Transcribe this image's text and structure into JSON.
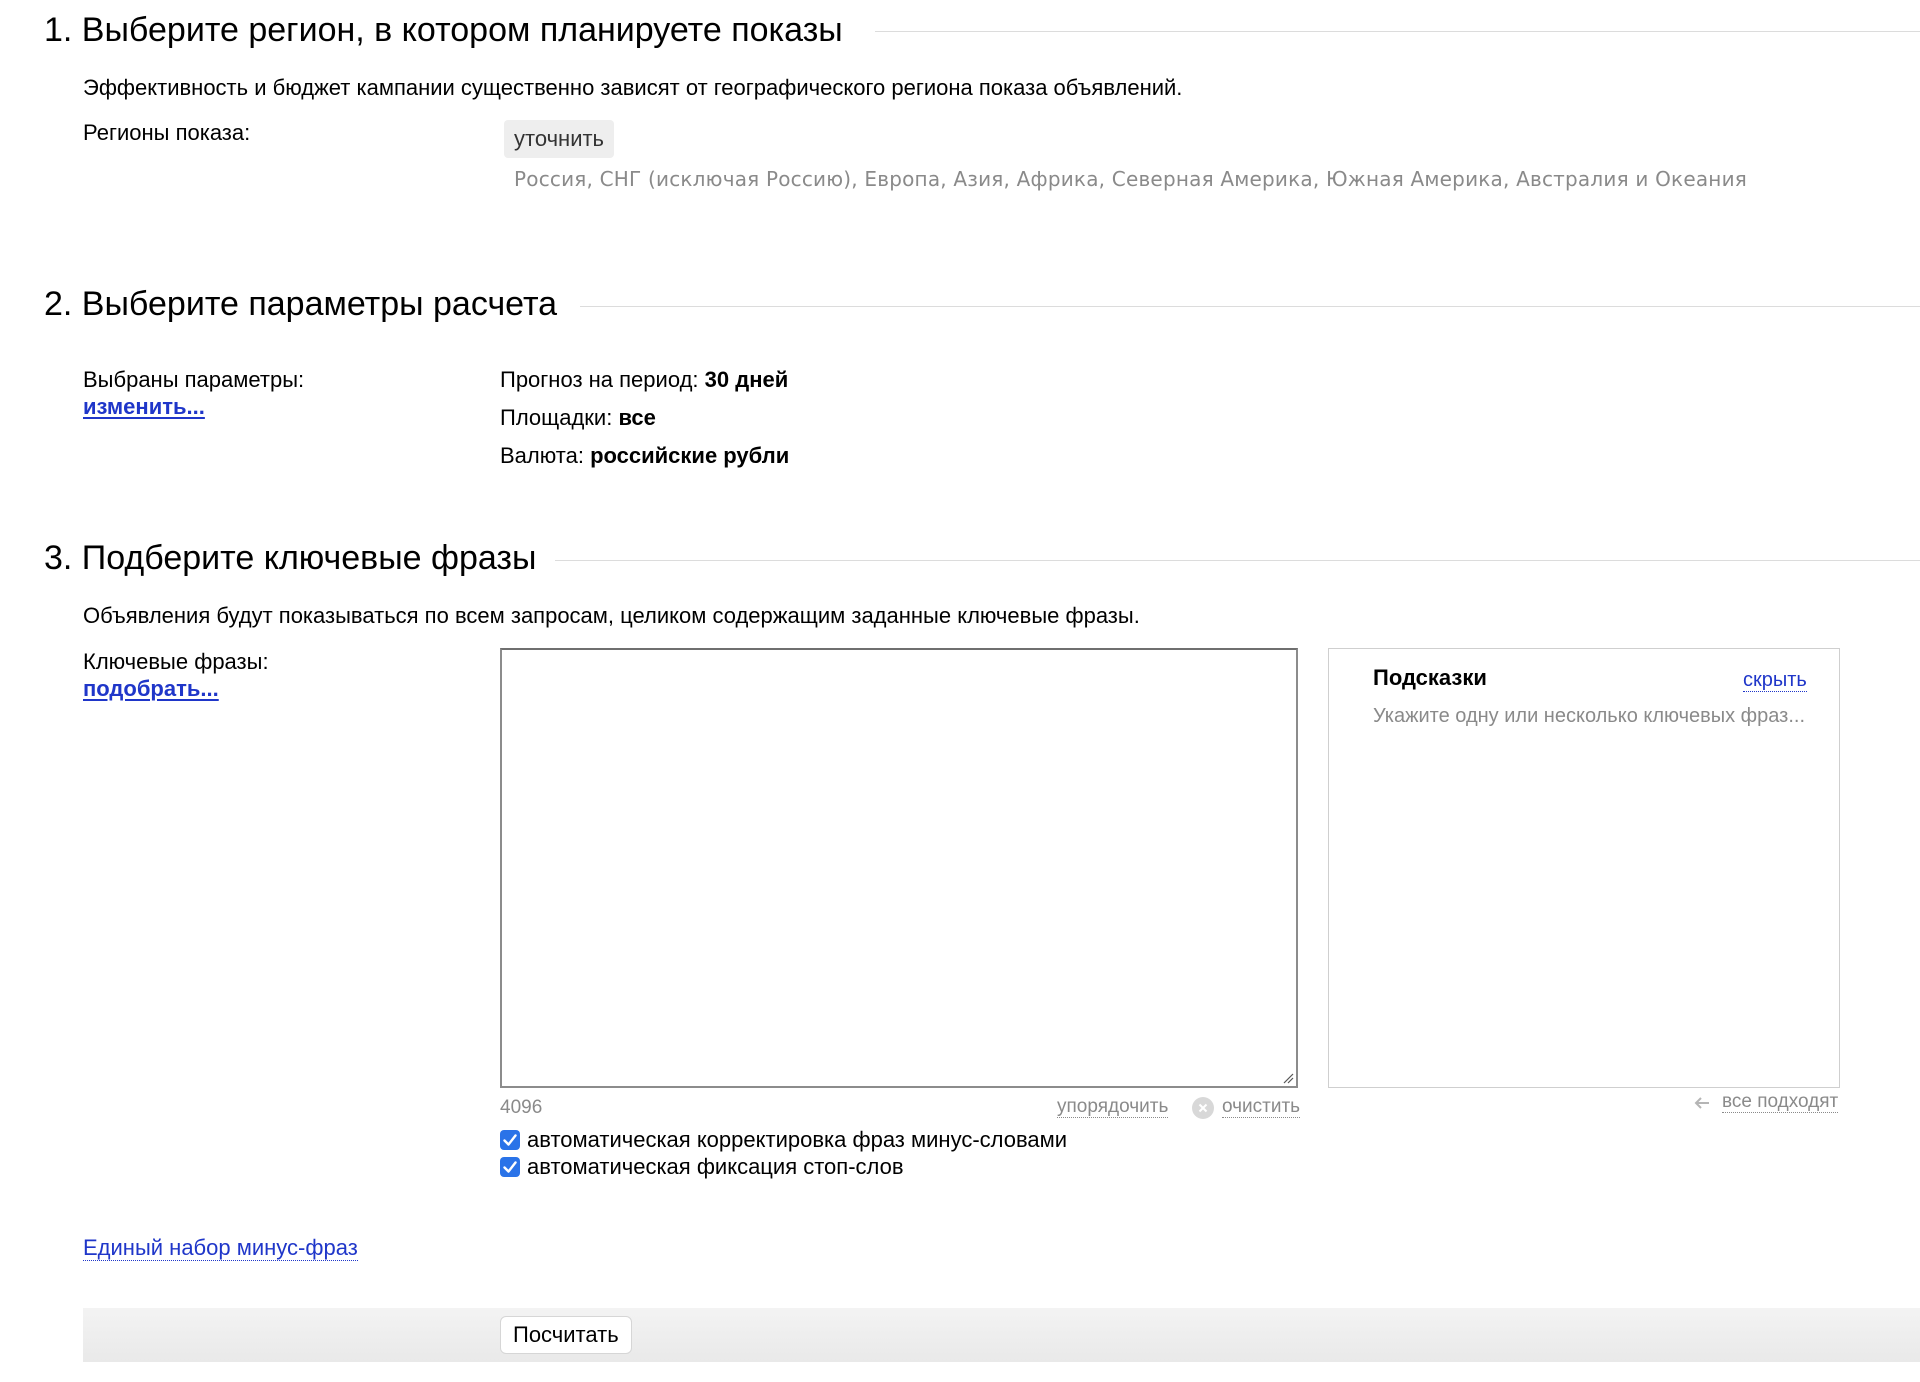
{
  "section1": {
    "title": "1. Выберите регион, в котором планируете показы",
    "description": "Эффективность и бюджет кампании существенно зависят от географического региона показа объявлений.",
    "regions_label": "Регионы показа:",
    "refine_button": "уточнить",
    "regions_value": "Россия, СНГ (исключая Россию), Европа, Азия, Африка, Северная Америка, Южная Америка, Австралия и Океания"
  },
  "section2": {
    "title": "2. Выберите параметры расчета",
    "params_label": "Выбраны параметры:",
    "change_link": "изменить...",
    "period_label": "Прогноз на период: ",
    "period_value": "30 дней",
    "platforms_label": "Площадки: ",
    "platforms_value": "все",
    "currency_label": "Валюта: ",
    "currency_value": "российские рубли"
  },
  "section3": {
    "title": "3. Подберите ключевые фразы",
    "description": "Объявления будут показываться по всем запросам, целиком содержащим заданные ключевые фразы.",
    "keywords_label": "Ключевые фразы:",
    "pick_link": "подобрать...",
    "keywords_value": "",
    "char_counter": "4096",
    "sort_link": "упорядочить",
    "clear_link": "очистить",
    "hints": {
      "title": "Подсказки",
      "hide_link": "скрыть",
      "placeholder": "Укажите одну или несколько ключевых фраз...",
      "all_fit_link": "все подходят"
    },
    "checkboxes": [
      {
        "label": "автоматическая корректировка фраз минус-словами",
        "checked": true
      },
      {
        "label": "автоматическая фиксация стоп-слов",
        "checked": true
      }
    ],
    "minus_phrases_link": "Единый набор минус-фраз"
  },
  "footer": {
    "calculate_button": "Посчитать"
  },
  "colors": {
    "link": "#1f36c9",
    "checkbox": "#2a73e8",
    "muted_text": "#8a8a8a",
    "rule": "#dcdcdc"
  }
}
